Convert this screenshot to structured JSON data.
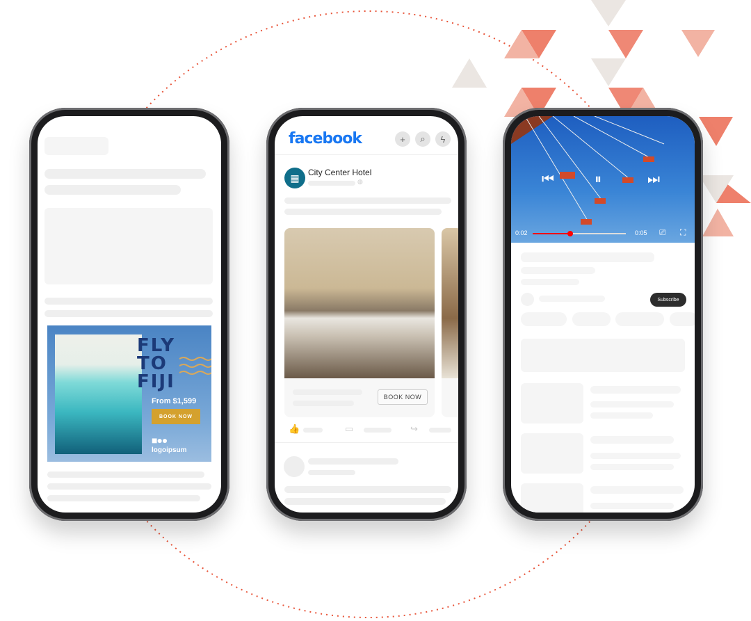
{
  "colors": {
    "accent": "#e8553a",
    "triangle_light": "#f2b3a3",
    "triangle_beige": "#ebe6e2",
    "facebook_blue": "#1877f2",
    "ad_gold": "#d4a12e",
    "progress_red": "#ff0000"
  },
  "phone1": {
    "ad": {
      "headline": "FLY\nTO\nFIJI",
      "price": "From $1,599",
      "cta": "BOOK NOW",
      "brand": "logoipsum",
      "brand_mark": "■●●"
    }
  },
  "phone2": {
    "app": "facebook",
    "icons": [
      "plus-icon",
      "search-icon",
      "messenger-icon"
    ],
    "post": {
      "page_name": "City Center Hotel",
      "cta": "BOOK NOW"
    }
  },
  "phone3": {
    "video": {
      "current_time": "0:02",
      "duration": "0:05",
      "progress": 0.4,
      "state": "playing"
    },
    "subscribe_label": "Subscribe"
  }
}
